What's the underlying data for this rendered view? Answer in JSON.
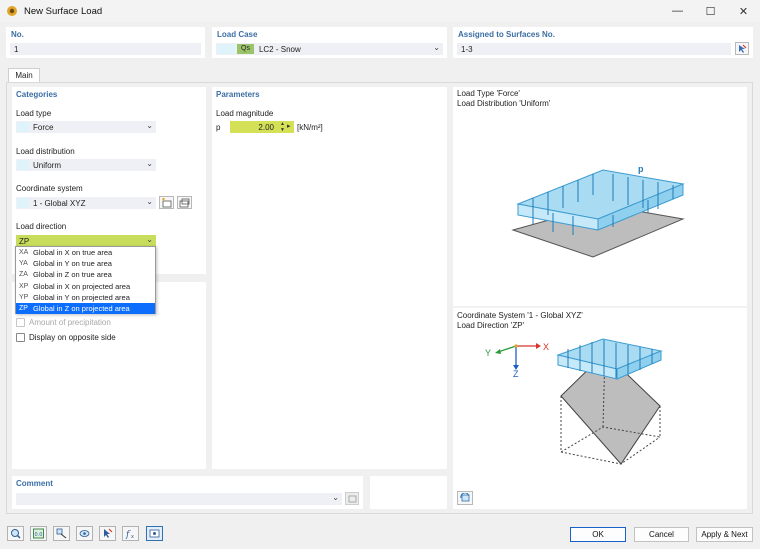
{
  "window": {
    "title": "New Surface Load",
    "minimize": "—",
    "maximize": "☐",
    "close": "✕"
  },
  "header": {
    "no_label": "No.",
    "no_value": "1",
    "load_case_label": "Load Case",
    "load_case_code": "Qs",
    "load_case_value": "LC2 - Snow",
    "assigned_label": "Assigned to Surfaces No.",
    "assigned_value": "1-3"
  },
  "tabs": [
    {
      "label": "Main"
    }
  ],
  "categories": {
    "title": "Categories",
    "load_type_label": "Load type",
    "load_type_value": "Force",
    "load_distribution_label": "Load distribution",
    "load_distribution_value": "Uniform",
    "coordinate_system_label": "Coordinate system",
    "coordinate_system_value": "1 - Global XYZ",
    "load_direction_label": "Load direction",
    "load_direction_value": "ZP"
  },
  "direction_options": [
    {
      "sym": "XA",
      "label": "Global in X on true area"
    },
    {
      "sym": "YA",
      "label": "Global in Y on true area"
    },
    {
      "sym": "ZA",
      "label": "Global in Z on true area"
    },
    {
      "sym": "XP",
      "label": "Global in X on projected area"
    },
    {
      "sym": "YP",
      "label": "Global in Y on projected area"
    },
    {
      "sym": "ZP",
      "label": "Global in Z on projected area"
    }
  ],
  "options": {
    "amount_precipitation": "Amount of precipitation",
    "display_opposite": "Display on opposite side"
  },
  "parameters": {
    "title": "Parameters",
    "load_magnitude_label": "Load magnitude",
    "p_symbol": "p",
    "p_value": "2.00",
    "p_unit": "[kN/m²]"
  },
  "preview_top": {
    "line1": "Load Type 'Force'",
    "line2": "Load Distribution 'Uniform'",
    "load_symbol": "p"
  },
  "preview_bottom": {
    "line1": "Coordinate System '1 - Global XYZ'",
    "line2": "Load Direction 'ZP'",
    "axis_x": "X",
    "axis_y": "Y",
    "axis_z": "Z"
  },
  "comment": {
    "label": "Comment",
    "value": ""
  },
  "footer": {
    "ok": "OK",
    "cancel": "Cancel",
    "apply_next": "Apply & Next"
  },
  "colors": {
    "accent": "#3b6ea5",
    "selection": "#0d6efd",
    "yellow_input": "#d4e157",
    "load_blue": "#9fd8f0"
  }
}
